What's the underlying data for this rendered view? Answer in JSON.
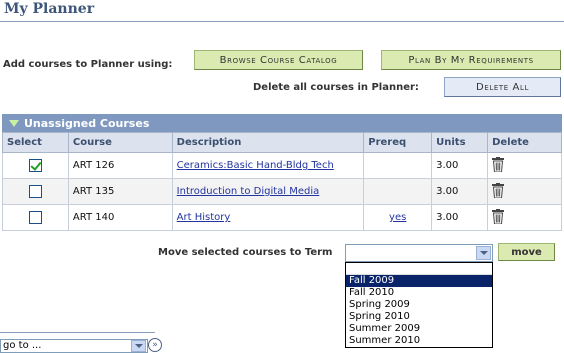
{
  "page_title": "My Planner",
  "add_courses": {
    "label": "Add courses to Planner using:",
    "browse_button": "Browse Course Catalog",
    "requirements_button": "Plan By My Requirements"
  },
  "delete_all": {
    "label": "Delete all courses in Planner:",
    "button": "Delete All"
  },
  "unassigned": {
    "title": "Unassigned Courses",
    "columns": [
      "Select",
      "Course",
      "Description",
      "Prereq",
      "Units",
      "Delete"
    ],
    "rows": [
      {
        "checked": true,
        "course": "ART 126",
        "description": "Ceramics:Basic Hand-Bldg Tech",
        "prereq": "",
        "units": "3.00"
      },
      {
        "checked": false,
        "course": "ART 135",
        "description": "Introduction to Digital Media",
        "prereq": "",
        "units": "3.00"
      },
      {
        "checked": false,
        "course": "ART 140",
        "description": "Art History",
        "prereq": "yes",
        "units": "3.00"
      }
    ]
  },
  "move": {
    "label": "Move selected courses to Term",
    "selected_value": "",
    "button": "move",
    "options": [
      "Fall 2009",
      "Fall 2010",
      "Spring 2009",
      "Spring 2010",
      "Summer 2009",
      "Summer 2010"
    ],
    "highlighted": "Fall 2009"
  },
  "goto": {
    "value": "go to ...",
    "go_icon": "double-chevron-right"
  }
}
